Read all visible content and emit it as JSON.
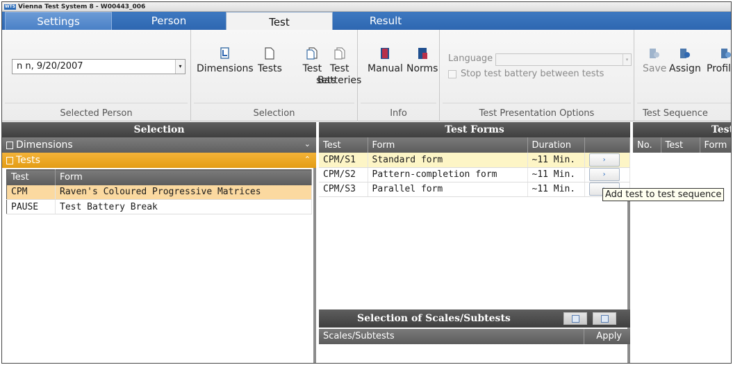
{
  "window": {
    "title": "Vienna Test System 8 - W00443_006",
    "logo": "WTS"
  },
  "tabs": [
    {
      "label": "Settings"
    },
    {
      "label": "Person"
    },
    {
      "label": "Test"
    },
    {
      "label": "Result"
    }
  ],
  "ribbon": {
    "selected_person": {
      "value": "n n, 9/20/2007",
      "group_label": "Selected Person"
    },
    "selection": {
      "group_label": "Selection",
      "buttons": [
        {
          "label": "Dimensions",
          "icon": "dimensions-icon"
        },
        {
          "label": "Tests",
          "icon": "tests-icon"
        },
        {
          "label_line1": "Test",
          "label_line2": "sets",
          "icon": "test-sets-icon"
        },
        {
          "label_line1": "Test",
          "label_line2": "Batteries",
          "icon": "test-batteries-icon"
        }
      ]
    },
    "info": {
      "group_label": "Info",
      "buttons": [
        {
          "label": "Manual",
          "icon": "manual-icon"
        },
        {
          "label": "Norms",
          "icon": "norms-icon"
        }
      ]
    },
    "options": {
      "group_label": "Test Presentation Options",
      "language_label": "Language",
      "stop_label": "Stop test battery between tests"
    },
    "sequence": {
      "group_label": "Test Sequence",
      "buttons": [
        {
          "label": "Save",
          "icon": "save-icon",
          "enabled": false
        },
        {
          "label": "Assign",
          "icon": "assign-icon",
          "enabled": true
        },
        {
          "label": "Profiling",
          "icon": "profiling-icon",
          "enabled": true
        }
      ]
    }
  },
  "selection_panel": {
    "header": "Selection",
    "dimensions_label": "Dimensions",
    "tests_label": "Tests",
    "columns": [
      "Test",
      "Form"
    ],
    "rows": [
      {
        "test": "CPM",
        "form": "Raven's Coloured Progressive Matrices",
        "selected": true
      },
      {
        "test": "PAUSE",
        "form": "Test Battery Break",
        "selected": false
      }
    ]
  },
  "forms_panel": {
    "header": "Test Forms",
    "columns": [
      "Test",
      "Form",
      "Duration"
    ],
    "rows": [
      {
        "test": "CPM/S1",
        "form": "Standard form",
        "duration": "~11 Min.",
        "selected": true
      },
      {
        "test": "CPM/S2",
        "form": "Pattern-completion form",
        "duration": "~11 Min.",
        "selected": false
      },
      {
        "test": "CPM/S3",
        "form": "Parallel form",
        "duration": "~11 Min.",
        "selected": false
      }
    ],
    "add_button_glyph": "›",
    "tooltip": "Add test to test sequence"
  },
  "scales_panel": {
    "header": "Selection of Scales/Subtests",
    "columns": [
      "Scales/Subtests",
      "Apply"
    ]
  },
  "sequence_panel": {
    "header": "Test",
    "columns": [
      "No.",
      "Test",
      "Form"
    ]
  },
  "colors": {
    "tab_bar": "#2e67b1",
    "panel_header": "#4a4a4a",
    "tests_accordion": "#e8a51f",
    "selected_row": "#fbd9a0",
    "selected_form_row": "#fdf5c6"
  }
}
